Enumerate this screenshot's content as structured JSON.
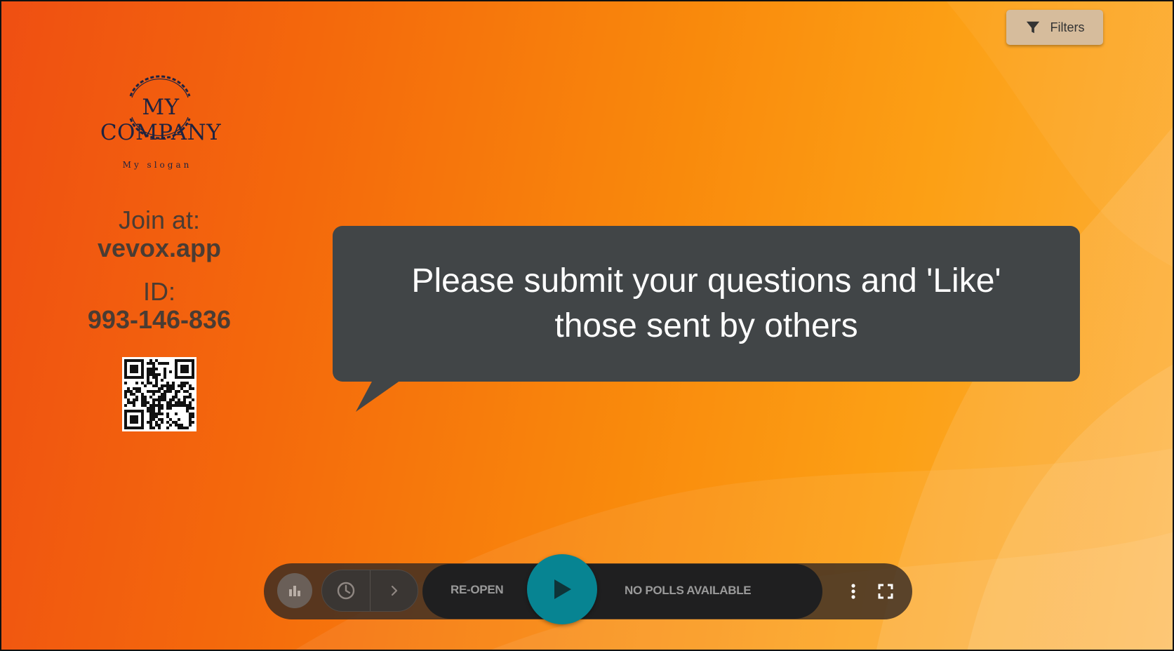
{
  "toolbar": {
    "filters_label": "Filters"
  },
  "branding": {
    "company_name": "MY COMPANY",
    "slogan": "My slogan"
  },
  "join": {
    "join_label": "Join at:",
    "join_url": "vevox.app",
    "id_label": "ID:",
    "id_value": "993-146-836"
  },
  "prompt": {
    "message": "Please submit your questions and 'Like' those sent by others"
  },
  "controls": {
    "reopen_label": "RE-OPEN",
    "status_label": "NO POLLS AVAILABLE",
    "icons": [
      "bar-chart-icon",
      "clock-icon",
      "chevron-right-icon",
      "play-icon",
      "more-vertical-icon",
      "fullscreen-icon",
      "filter-icon"
    ]
  },
  "colors": {
    "play_accent": "#078492",
    "bubble_bg": "#414547",
    "background_start": "#ef4f12",
    "background_end": "#fdb03a"
  }
}
